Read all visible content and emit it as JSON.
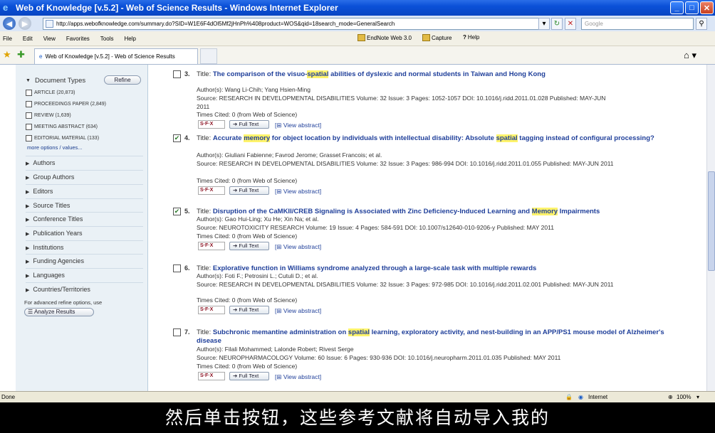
{
  "window": {
    "title": "Web of Knowledge [v.5.2] - Web of Science Results - Windows Internet Explorer"
  },
  "address": {
    "url": "http://apps.webofknowledge.com/summary.do?SID=W1E6F4dOl5Mf2jHnPh%408product=WOS&qid=18search_mode=GeneralSearch",
    "search_placeholder": "Google"
  },
  "menu": {
    "items": [
      "File",
      "Edit",
      "View",
      "Favorites",
      "Tools",
      "Help"
    ],
    "endnote": "EndNote Web 3.0",
    "capture": "Capture",
    "help": "Help"
  },
  "tab": {
    "title": "Web of Knowledge [v.5.2] - Web of Science Results"
  },
  "sidebar": {
    "doc_types_title": "Document Types",
    "refine_label": "Refine",
    "doc_types": [
      "ARTICLE (20,873)",
      "PROCEEDINGS PAPER (2,849)",
      "REVIEW (1,639)",
      "MEETING ABSTRACT (634)",
      "EDITORIAL MATERIAL (133)"
    ],
    "more_options": "more options / values...",
    "sections": [
      "Authors",
      "Group Authors",
      "Editors",
      "Source Titles",
      "Conference Titles",
      "Publication Years",
      "Institutions",
      "Funding Agencies",
      "Languages",
      "Countries/Territories"
    ],
    "advanced_text": "For advanced refine options, use",
    "analyze_label": "Analyze Results"
  },
  "buttons": {
    "full_text": "Full Text",
    "view_abstract": "View abstract",
    "sfx": "S·F·X"
  },
  "records": [
    {
      "num": "3.",
      "checked": false,
      "title_parts": [
        [
          "The comparison of the visuo-",
          ""
        ],
        [
          "spatial",
          "hl"
        ],
        [
          " abilities of dyslexic and normal students in Taiwan and Hong Kong",
          ""
        ]
      ],
      "authors": "Author(s): Wang Li-Chih; Yang Hsien-Ming",
      "source": "Source: RESEARCH IN DEVELOPMENTAL DISABILITIES  Volume: 32  Issue: 3  Pages: 1052-1057  DOI: 10.1016/j.ridd.2011.01.028  Published: MAY-JUN",
      "source2": "2011",
      "cited": "Times Cited: 0 (from Web of Science)"
    },
    {
      "num": "4.",
      "checked": true,
      "title_parts": [
        [
          "Accurate ",
          ""
        ],
        [
          "memory",
          "hl"
        ],
        [
          " for object location by individuals with intellectual disability: Absolute ",
          ""
        ],
        [
          "spatial",
          "hl"
        ],
        [
          " tagging instead of configural processing?",
          ""
        ]
      ],
      "authors": "Author(s): Giuliani Fabienne; Favrod Jerome; Grasset Francois; et al.",
      "source": "Source: RESEARCH IN DEVELOPMENTAL DISABILITIES  Volume: 32  Issue: 3  Pages: 986-994  DOI: 10.1016/j.ridd.2011.01.055  Published: MAY-JUN 2011",
      "source2": "",
      "cited": "Times Cited: 0 (from Web of Science)"
    },
    {
      "num": "5.",
      "checked": true,
      "title_parts": [
        [
          "Disruption of the CaMKII/CREB Signaling is Associated with Zinc Deficiency-Induced Learning and ",
          ""
        ],
        [
          "Memory",
          "hl"
        ],
        [
          " Impairments",
          ""
        ]
      ],
      "authors": "Author(s): Gao Hui-Ling; Xu He; Xin Na; et al.",
      "source": "Source: NEUROTOXICITY RESEARCH  Volume: 19  Issue: 4  Pages: 584-591  DOI: 10.1007/s12640-010-9206-y  Published: MAY 2011",
      "source2": "",
      "cited": "Times Cited: 0 (from Web of Science)"
    },
    {
      "num": "6.",
      "checked": false,
      "title_parts": [
        [
          "Explorative function in Williams syndrome analyzed through a large-scale task with multiple rewards",
          ""
        ]
      ],
      "authors": "Author(s): Foti F.; Petrosini L.; Cutuli D.; et al.",
      "source": "Source: RESEARCH IN DEVELOPMENTAL DISABILITIES  Volume: 32  Issue: 3  Pages: 972-985  DOI: 10.1016/j.ridd.2011.02.001  Published: MAY-JUN 2011",
      "source2": "",
      "cited": "Times Cited: 0 (from Web of Science)"
    },
    {
      "num": "7.",
      "checked": false,
      "title_parts": [
        [
          "Subchronic memantine administration on ",
          ""
        ],
        [
          "spatial",
          "hl"
        ],
        [
          " learning, exploratory activity, and nest-building in an APP/PS1 mouse model of Alzheimer's disease",
          ""
        ]
      ],
      "authors": "Author(s): Filali Mohammed; Lalonde Robert; Rivest Serge",
      "source": "Source: NEUROPHARMACOLOGY  Volume: 60  Issue: 6  Pages: 930-936  DOI: 10.1016/j.neuropharm.2011.01.035  Published: MAY 2011",
      "source2": "",
      "cited": "Times Cited: 0 (from Web of Science)"
    }
  ],
  "status": {
    "left": "Done",
    "zone": "Internet",
    "zoom": "100%"
  },
  "subtitle": "然后单击按钮，这些参考文献将自动导入我的"
}
